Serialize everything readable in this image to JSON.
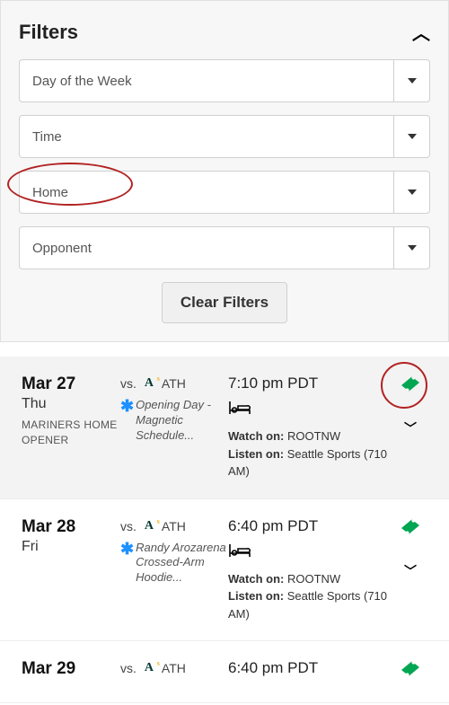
{
  "filters": {
    "title": "Filters",
    "options": [
      {
        "label": "Day of the Week"
      },
      {
        "label": "Time"
      },
      {
        "label": "Home"
      },
      {
        "label": "Opponent"
      }
    ],
    "clear_label": "Clear Filters"
  },
  "games": [
    {
      "date": "Mar 27",
      "day": "Thu",
      "subtitle": "MARINERS HOME OPENER",
      "vs_label": "vs.",
      "opp_code": "ATH",
      "promo": "Opening Day - Magnetic Schedule...",
      "time": "7:10 pm PDT",
      "watch_label": "Watch on:",
      "watch_value": "ROOTNW",
      "listen_label": "Listen on:",
      "listen_value": "Seattle Sports (710 AM)"
    },
    {
      "date": "Mar 28",
      "day": "Fri",
      "subtitle": "",
      "vs_label": "vs.",
      "opp_code": "ATH",
      "promo": "Randy Arozarena Crossed-Arm Hoodie...",
      "time": "6:40 pm PDT",
      "watch_label": "Watch on:",
      "watch_value": "ROOTNW",
      "listen_label": "Listen on:",
      "listen_value": "Seattle Sports (710 AM)"
    },
    {
      "date": "Mar 29",
      "day": "",
      "subtitle": "",
      "vs_label": "vs.",
      "opp_code": "ATH",
      "promo": "",
      "time": "6:40 pm PDT",
      "watch_label": "",
      "watch_value": "",
      "listen_label": "",
      "listen_value": ""
    }
  ]
}
